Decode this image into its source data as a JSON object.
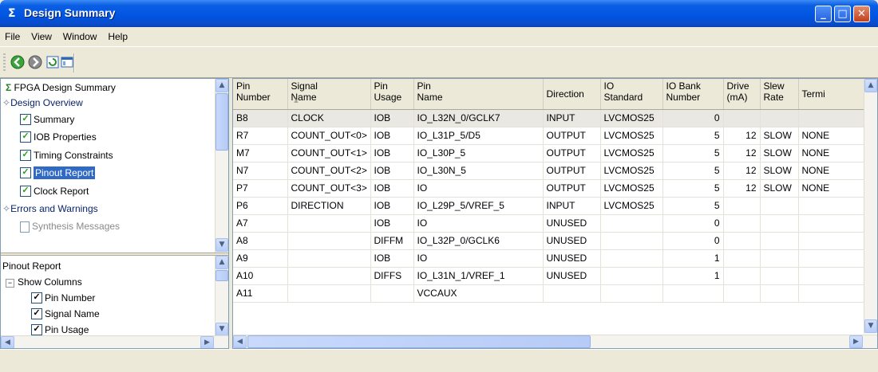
{
  "window": {
    "title": "Design Summary",
    "icon": "sigma-icon"
  },
  "menu": [
    "File",
    "View",
    "Window",
    "Help"
  ],
  "toolbar": {
    "icons": [
      "back-arrow-icon",
      "forward-arrow-icon",
      "refresh-icon",
      "window-icon"
    ]
  },
  "tree": {
    "root": "FPGA Design Summary",
    "items": [
      {
        "label": "Design Overview",
        "type": "group"
      },
      {
        "label": "Summary",
        "type": "check"
      },
      {
        "label": "IOB Properties",
        "type": "check"
      },
      {
        "label": "Timing Constraints",
        "type": "check"
      },
      {
        "label": "Pinout Report",
        "type": "check",
        "selected": true
      },
      {
        "label": "Clock Report",
        "type": "check"
      },
      {
        "label": "Errors and Warnings",
        "type": "group"
      },
      {
        "label": "Synthesis Messages",
        "type": "page"
      }
    ]
  },
  "options": {
    "title": "Pinout Report",
    "group": "Show Columns",
    "items": [
      "Pin Number",
      "Signal Name",
      "Pin Usage"
    ]
  },
  "grid": {
    "headers": [
      "Pin\nNumber",
      "Signal\nName",
      "Pin\nUsage",
      "Pin\nName",
      "Direction",
      "IO\nStandard",
      "IO Bank\nNumber",
      "Drive\n(mA)",
      "Slew\nRate",
      "Termi"
    ],
    "rows": [
      [
        "B8",
        "CLOCK",
        "IOB",
        "IO_L32N_0/GCLK7",
        "INPUT",
        "LVCMOS25",
        "0",
        "",
        "",
        ""
      ],
      [
        "R7",
        "COUNT_OUT<0>",
        "IOB",
        "IO_L31P_5/D5",
        "OUTPUT",
        "LVCMOS25",
        "5",
        "12",
        "SLOW",
        "NONE"
      ],
      [
        "M7",
        "COUNT_OUT<1>",
        "IOB",
        "IO_L30P_5",
        "OUTPUT",
        "LVCMOS25",
        "5",
        "12",
        "SLOW",
        "NONE"
      ],
      [
        "N7",
        "COUNT_OUT<2>",
        "IOB",
        "IO_L30N_5",
        "OUTPUT",
        "LVCMOS25",
        "5",
        "12",
        "SLOW",
        "NONE"
      ],
      [
        "P7",
        "COUNT_OUT<3>",
        "IOB",
        "IO",
        "OUTPUT",
        "LVCMOS25",
        "5",
        "12",
        "SLOW",
        "NONE"
      ],
      [
        "P6",
        "DIRECTION",
        "IOB",
        "IO_L29P_5/VREF_5",
        "INPUT",
        "LVCMOS25",
        "5",
        "",
        "",
        ""
      ],
      [
        "A7",
        "",
        "IOB",
        "IO",
        "UNUSED",
        "",
        "0",
        "",
        "",
        ""
      ],
      [
        "A8",
        "",
        "DIFFM",
        "IO_L32P_0/GCLK6",
        "UNUSED",
        "",
        "0",
        "",
        "",
        ""
      ],
      [
        "A9",
        "",
        "IOB",
        "IO",
        "UNUSED",
        "",
        "1",
        "",
        "",
        ""
      ],
      [
        "A10",
        "",
        "DIFFS",
        "IO_L31N_1/VREF_1",
        "UNUSED",
        "",
        "1",
        "",
        "",
        ""
      ],
      [
        "A11",
        "",
        "",
        "VCCAUX",
        "",
        "",
        "",
        "",
        "",
        ""
      ]
    ]
  },
  "colors": {
    "titlebar": "#0054e3",
    "selection": "#316ac5",
    "face": "#ece9d8"
  }
}
